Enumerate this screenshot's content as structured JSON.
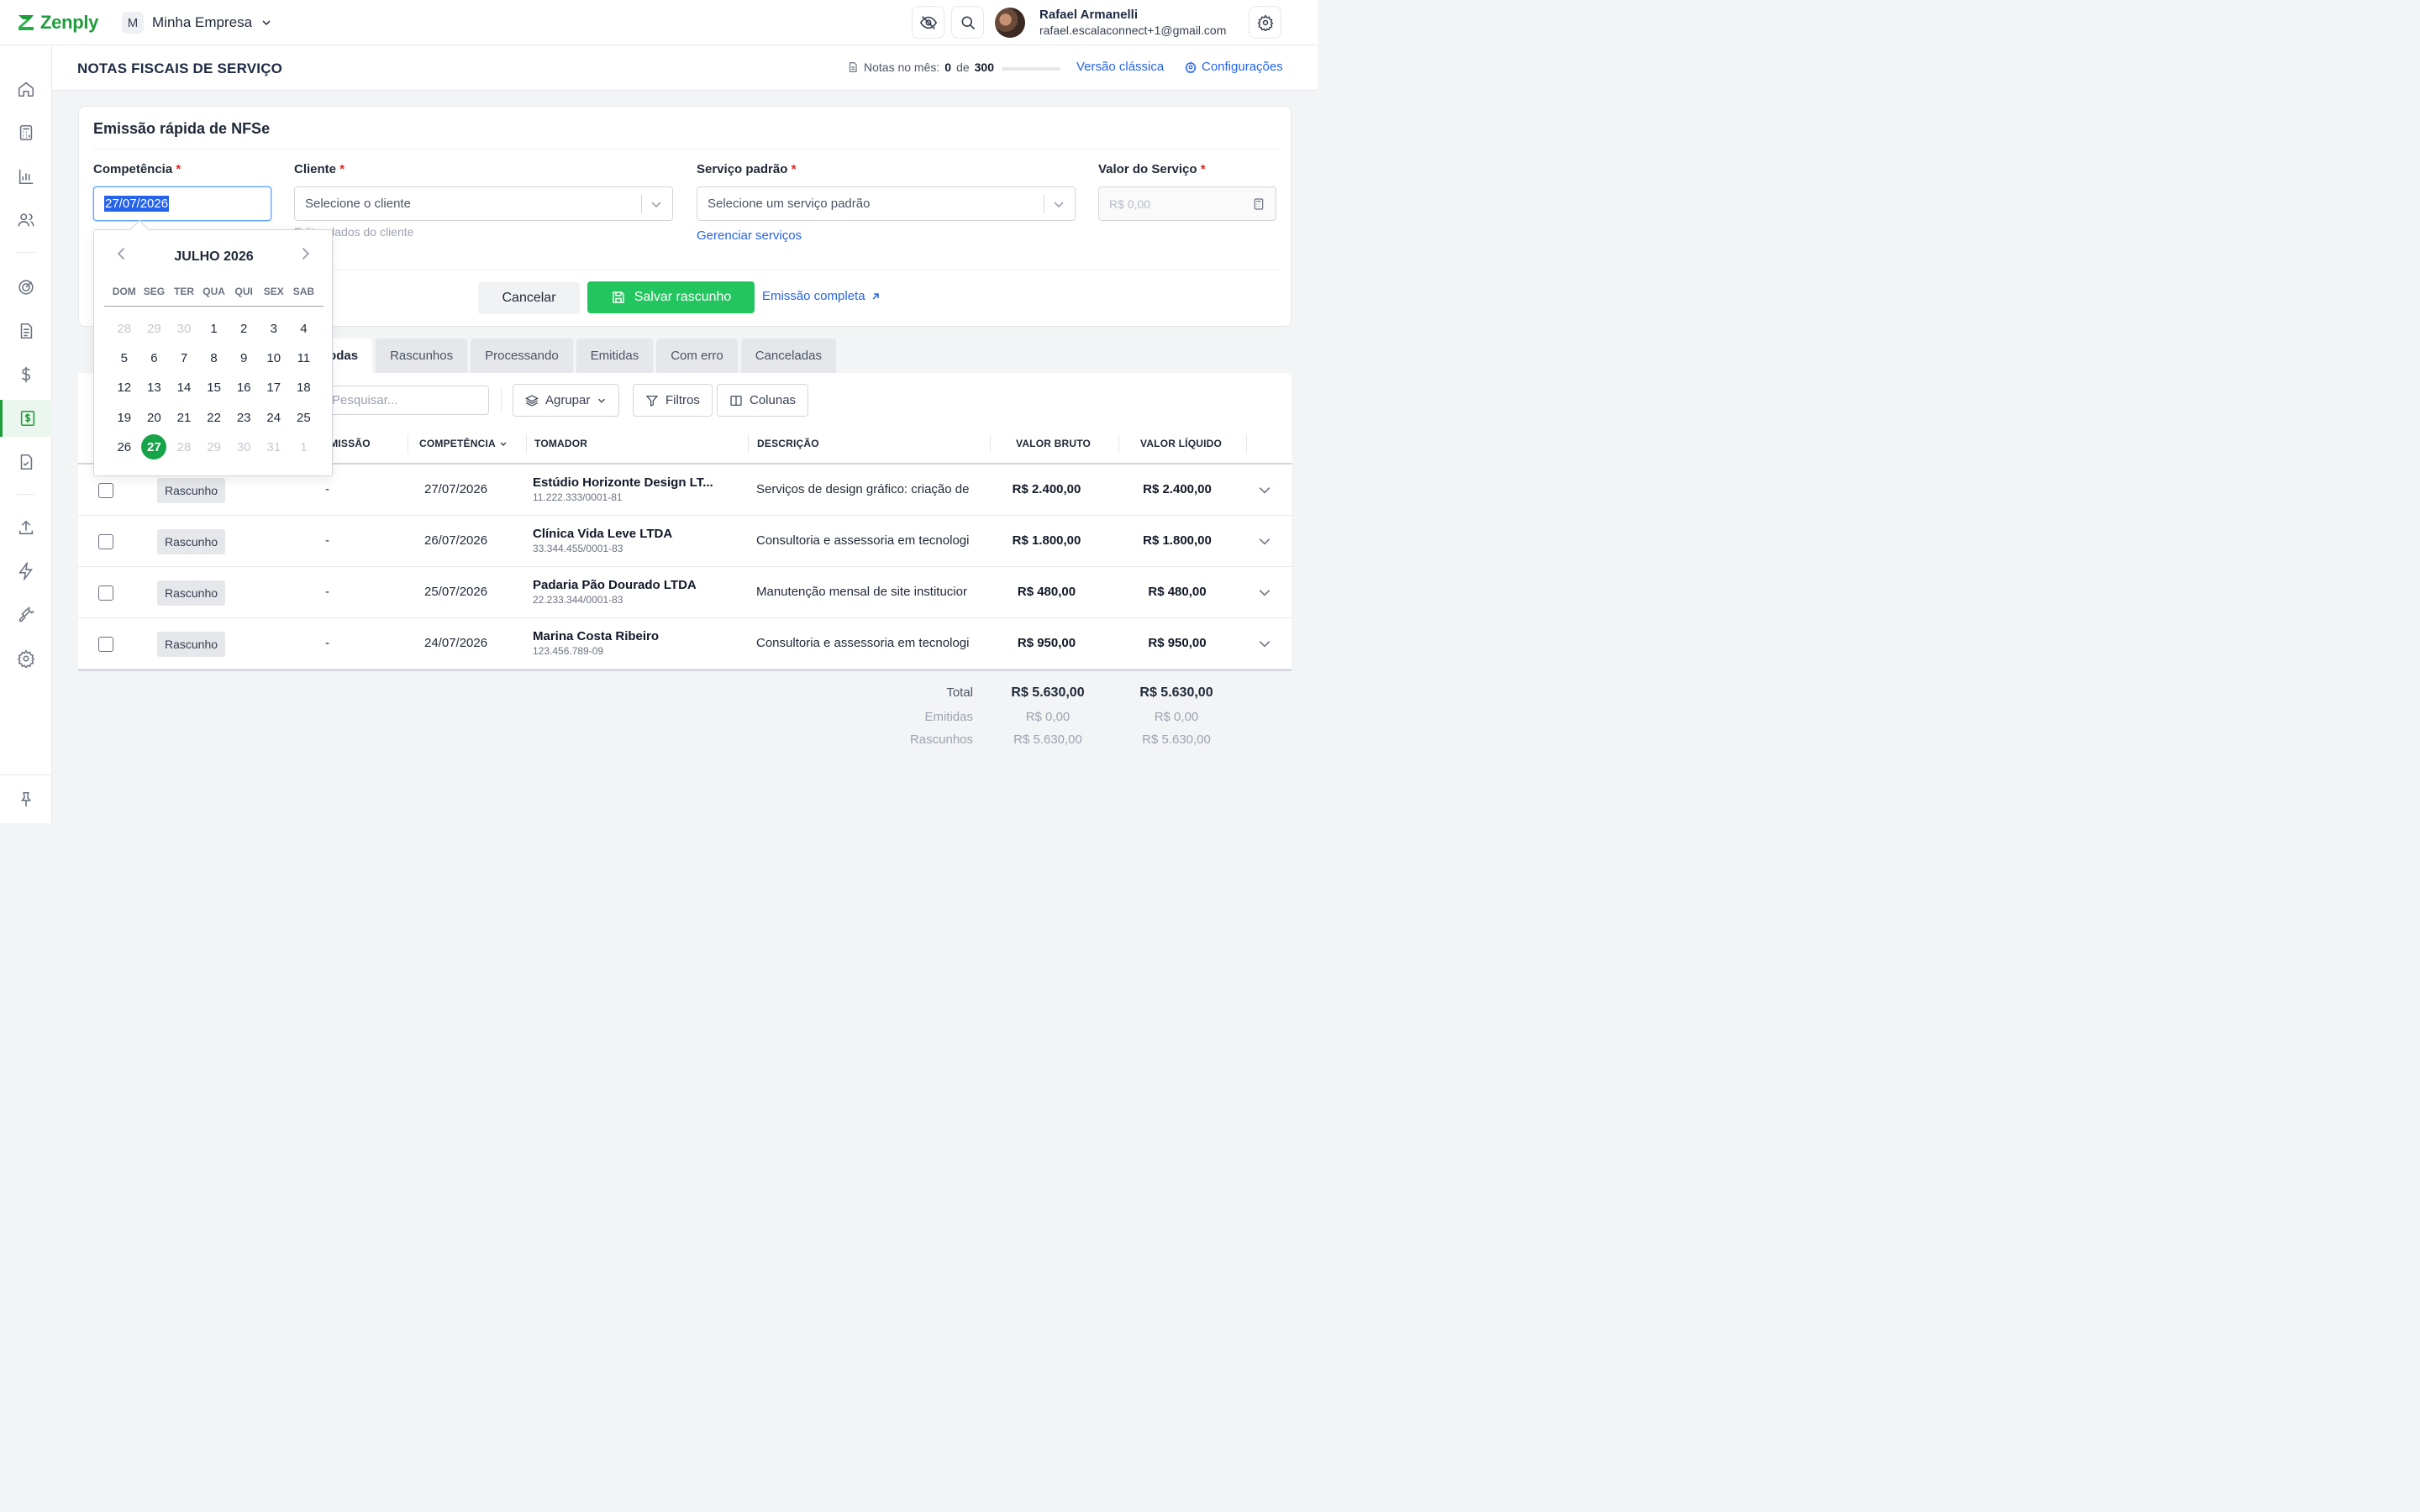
{
  "brand": {
    "name": "Zenply",
    "color": "#1f9d3a"
  },
  "company": {
    "initial": "M",
    "name": "Minha Empresa"
  },
  "user": {
    "name": "Rafael Armanelli",
    "email": "rafael.escalaconnect+1@gmail.com"
  },
  "page": {
    "title": "NOTAS FISCAIS DE SERVIÇO",
    "notes_label": "Notas no mês:",
    "notes_used": "0",
    "notes_of": "de",
    "notes_total": "300",
    "notes_progress": 0,
    "classic_link": "Versão clássica",
    "settings_link": "Configurações"
  },
  "quick": {
    "title": "Emissão rápida de NFSe",
    "req_mark": "*",
    "competencia_label": "Competência",
    "competencia_value": "27/07/2026",
    "cliente_label": "Cliente",
    "cliente_placeholder": "Selecione o cliente",
    "cliente_helper": "Editar dados do cliente",
    "servico_label": "Serviço padrão",
    "servico_placeholder": "Selecione um serviço padrão",
    "servico_link": "Gerenciar serviços",
    "valor_label": "Valor do Serviço",
    "valor_placeholder": "R$ 0,00",
    "cancel": "Cancelar",
    "save": "Salvar rascunho",
    "full": "Emissão completa"
  },
  "tabs": [
    "Todas",
    "Rascunhos",
    "Processando",
    "Emitidas",
    "Com erro",
    "Canceladas"
  ],
  "toolbar": {
    "search_placeholder": "Pesquisar...",
    "group": "Agrupar",
    "filters": "Filtros",
    "columns": "Colunas"
  },
  "columns": {
    "emissao": "EMISSÃO",
    "competencia": "COMPETÊNCIA",
    "tomador": "TOMADOR",
    "descricao": "DESCRIÇÃO",
    "bruto": "VALOR BRUTO",
    "liquido": "VALOR LÍQUIDO"
  },
  "rows": [
    {
      "status": "Rascunho",
      "emissao": "-",
      "competencia": "27/07/2026",
      "tomador": "Estúdio Horizonte Design LT...",
      "doc": "11.222.333/0001-81",
      "descricao": "Serviços de design gráfico: criação de",
      "bruto": "R$ 2.400,00",
      "liquido": "R$ 2.400,00"
    },
    {
      "status": "Rascunho",
      "emissao": "-",
      "competencia": "26/07/2026",
      "tomador": "Clínica Vida Leve LTDA",
      "doc": "33.344.455/0001-83",
      "descricao": "Consultoria e assessoria em tecnologi",
      "bruto": "R$ 1.800,00",
      "liquido": "R$ 1.800,00"
    },
    {
      "status": "Rascunho",
      "emissao": "-",
      "competencia": "25/07/2026",
      "tomador": "Padaria Pão Dourado LTDA",
      "doc": "22.233.344/0001-83",
      "descricao": "Manutenção mensal de site institucior",
      "bruto": "R$ 480,00",
      "liquido": "R$ 480,00"
    },
    {
      "status": "Rascunho",
      "emissao": "-",
      "competencia": "24/07/2026",
      "tomador": "Marina Costa Ribeiro",
      "doc": "123.456.789-09",
      "descricao": "Consultoria e assessoria em tecnologi",
      "bruto": "R$ 950,00",
      "liquido": "R$ 950,00"
    }
  ],
  "totals": [
    {
      "label": "Total",
      "bruto": "R$ 5.630,00",
      "liquido": "R$ 5.630,00"
    },
    {
      "label": "Emitidas",
      "bruto": "R$ 0,00",
      "liquido": "R$ 0,00"
    },
    {
      "label": "Rascunhos",
      "bruto": "R$ 5.630,00",
      "liquido": "R$ 5.630,00"
    }
  ],
  "calendar": {
    "month": "JULHO 2026",
    "dows": [
      "DOM",
      "SEG",
      "TER",
      "QUA",
      "QUI",
      "SEX",
      "SAB"
    ],
    "weeks": [
      [
        "28",
        "29",
        "30",
        "1",
        "2",
        "3",
        "4"
      ],
      [
        "5",
        "6",
        "7",
        "8",
        "9",
        "10",
        "11"
      ],
      [
        "12",
        "13",
        "14",
        "15",
        "16",
        "17",
        "18"
      ],
      [
        "19",
        "20",
        "21",
        "22",
        "23",
        "24",
        "25"
      ],
      [
        "26",
        "27",
        "28",
        "29",
        "30",
        "31",
        "1"
      ]
    ],
    "selected": "27"
  },
  "sidebar_icons": [
    "home-icon",
    "calculator-icon",
    "bar-chart-icon",
    "users-icon",
    "target-icon",
    "document-icon",
    "dollar-icon",
    "invoice-dollar-icon",
    "checklist-icon",
    "upload-icon",
    "lightning-icon",
    "plug-icon",
    "gear-icon",
    "pin-icon"
  ]
}
